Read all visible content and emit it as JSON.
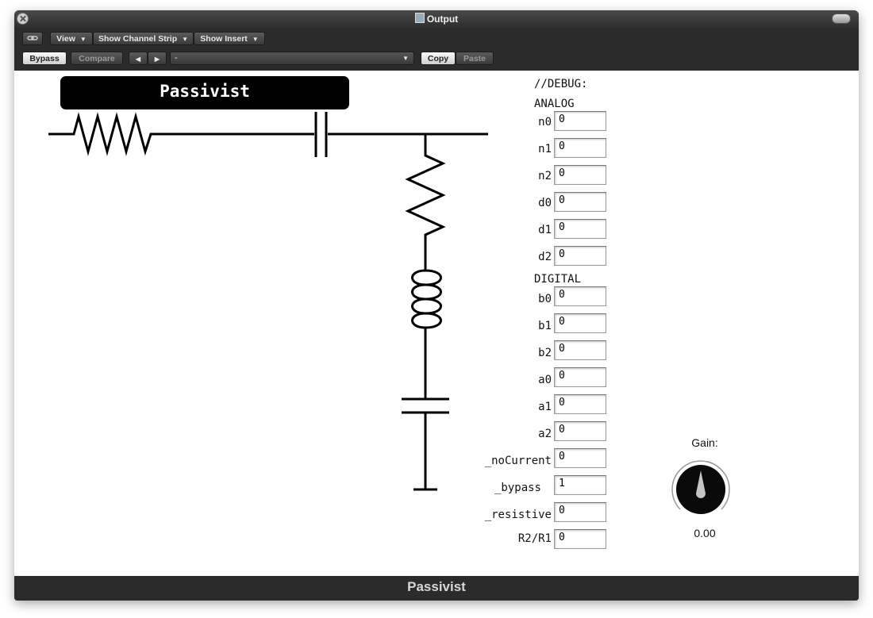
{
  "window": {
    "title": "Output"
  },
  "toolbar": {
    "view_label": "View",
    "channel_strip_label": "Show Channel Strip",
    "insert_label": "Show Insert",
    "bypass_label": "Bypass",
    "compare_label": "Compare",
    "prev_icon": "◀",
    "next_icon": "▶",
    "preset_value": "-",
    "copy_label": "Copy",
    "paste_label": "Paste"
  },
  "plugin": {
    "name": "Passivist",
    "debug_header": "//DEBUG:",
    "analog_header": "ANALOG",
    "digital_header": "DIGITAL",
    "analog_params": [
      {
        "label": "n0",
        "value": "0"
      },
      {
        "label": "n1",
        "value": "0"
      },
      {
        "label": "n2",
        "value": "0"
      },
      {
        "label": "d0",
        "value": "0"
      },
      {
        "label": "d1",
        "value": "0"
      },
      {
        "label": "d2",
        "value": "0"
      }
    ],
    "digital_params": [
      {
        "label": "b0",
        "value": "0"
      },
      {
        "label": "b1",
        "value": "0"
      },
      {
        "label": "b2",
        "value": "0"
      },
      {
        "label": "a0",
        "value": "0"
      },
      {
        "label": "a1",
        "value": "0"
      },
      {
        "label": "a2",
        "value": "0"
      },
      {
        "label": "_noCurrent",
        "value": "0"
      },
      {
        "label": "_bypass",
        "value": "1"
      },
      {
        "label": "_resistive",
        "value": "0"
      },
      {
        "label": "R2/R1",
        "value": "0"
      }
    ],
    "gain": {
      "label": "Gain:",
      "value": "0.00"
    }
  },
  "footer": {
    "name": "Passivist"
  },
  "icons": [
    "close-icon",
    "zoom-icon",
    "link-icon",
    "document-icon",
    "chevron-down-icon"
  ]
}
